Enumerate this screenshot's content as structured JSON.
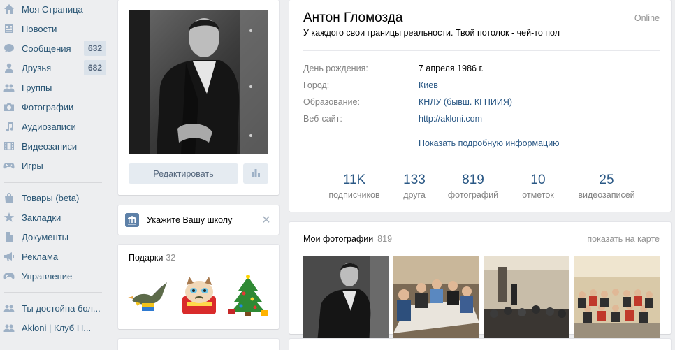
{
  "nav": {
    "items": [
      {
        "label": "Моя Страница",
        "icon": "home-icon"
      },
      {
        "label": "Новости",
        "icon": "news-icon"
      },
      {
        "label": "Сообщения",
        "icon": "message-icon",
        "count": "632"
      },
      {
        "label": "Друзья",
        "icon": "user-icon",
        "count": "682"
      },
      {
        "label": "Группы",
        "icon": "group-icon"
      },
      {
        "label": "Фотографии",
        "icon": "camera-icon"
      },
      {
        "label": "Аудиозаписи",
        "icon": "music-icon"
      },
      {
        "label": "Видеозаписи",
        "icon": "film-icon"
      },
      {
        "label": "Игры",
        "icon": "gamepad-icon"
      },
      {
        "label": "Товары (beta)",
        "icon": "bag-icon"
      },
      {
        "label": "Закладки",
        "icon": "star-icon"
      },
      {
        "label": "Документы",
        "icon": "document-icon"
      },
      {
        "label": "Реклама",
        "icon": "megaphone-icon"
      },
      {
        "label": "Управление",
        "icon": "gamepad-icon"
      },
      {
        "label": "Ты достойна бол...",
        "icon": "group-icon"
      },
      {
        "label": "Akloni | Клуб Н...",
        "icon": "group-icon"
      }
    ]
  },
  "avatar": {
    "edit_label": "Редактировать",
    "stats_icon": "bar-chart-icon"
  },
  "school": {
    "label": "Укажите Вашу школу",
    "close": "✕"
  },
  "gifts": {
    "title": "Подарки",
    "count": "32"
  },
  "profile": {
    "name": "Антон Гломозда",
    "online": "Online",
    "status": "У каждого свои границы реальности. Твой потолок - чей-то пол",
    "info": [
      {
        "label": "День рождения:",
        "value": "7 апреля 1986 г.",
        "link": false
      },
      {
        "label": "Город:",
        "value": "Киев",
        "link": true
      },
      {
        "label": "Образование:",
        "value": "КНЛУ (бывш. КГПИИЯ)",
        "link": true
      },
      {
        "label": "Веб-сайт:",
        "value": "http://akloni.com",
        "link": true
      }
    ],
    "more_info": "Показать подробную информацию",
    "counters": [
      {
        "num": "11K",
        "cap": "подписчиков"
      },
      {
        "num": "133",
        "cap": "друга"
      },
      {
        "num": "819",
        "cap": "фотографий"
      },
      {
        "num": "10",
        "cap": "отметок"
      },
      {
        "num": "25",
        "cap": "видеозаписей"
      }
    ]
  },
  "photos": {
    "title": "Мои фотографии",
    "count": "819",
    "map_link": "показать на карте"
  },
  "colors": {
    "accent": "#2a5885",
    "nav_text": "#285473",
    "background": "#edeef0",
    "muted": "#828282"
  }
}
